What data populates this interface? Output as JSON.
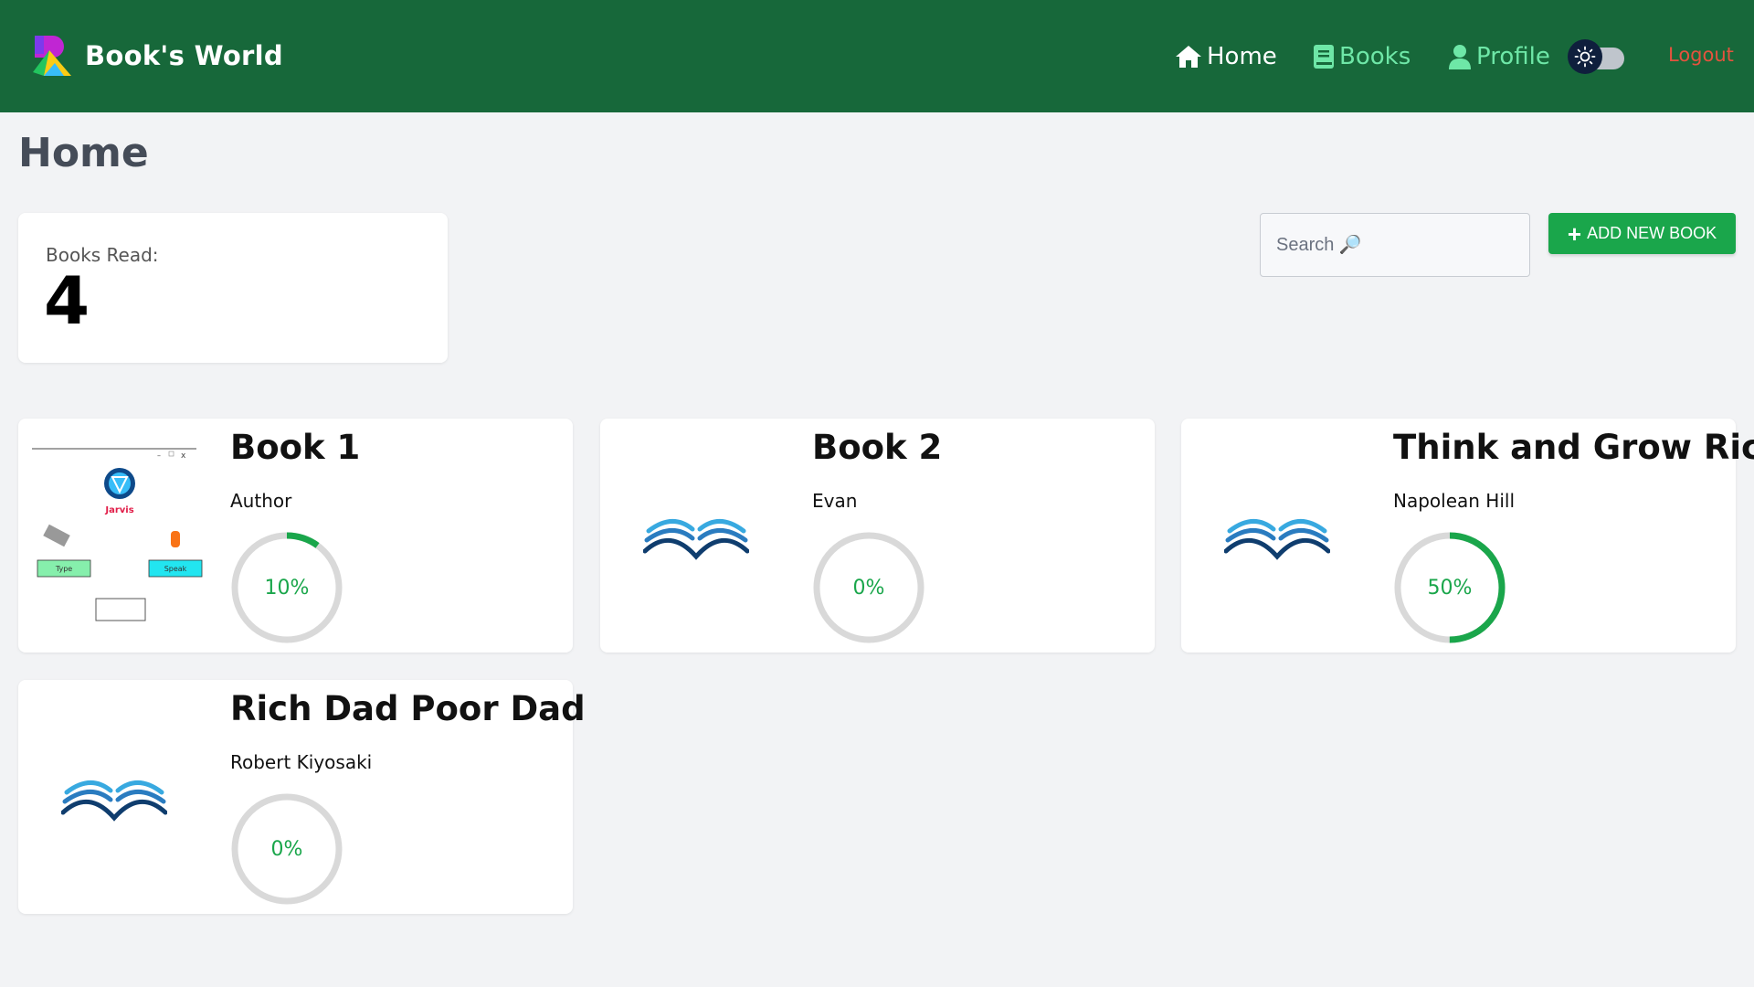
{
  "app": {
    "name": "Book's World",
    "accent_color": "#17683a",
    "button_color": "#1aa64b",
    "logout_color": "#e4533e"
  },
  "nav": {
    "home": {
      "label": "Home",
      "icon": "home-icon"
    },
    "books": {
      "label": "Books",
      "icon": "book-icon"
    },
    "profile": {
      "label": "Profile",
      "icon": "user-icon"
    },
    "theme_toggle": {
      "icon": "sun-icon",
      "state": "off"
    },
    "logout": {
      "label": "Logout"
    }
  },
  "page": {
    "title": "Home"
  },
  "stats": {
    "books_read_label": "Books Read:",
    "books_read_value": "4"
  },
  "search": {
    "placeholder": "Search 🔎",
    "value": ""
  },
  "actions": {
    "add_book_label": "ADD NEW BOOK"
  },
  "books": [
    {
      "title": "Book 1",
      "author": "Author",
      "progress": 10,
      "progress_label": "10%",
      "cover": "screenshot-cover"
    },
    {
      "title": "Book 2",
      "author": "Evan",
      "progress": 0,
      "progress_label": "0%",
      "cover": "open-book-icon"
    },
    {
      "title": "Think and Grow Rich",
      "author": "Napolean Hill",
      "progress": 50,
      "progress_label": "50%",
      "cover": "open-book-icon"
    },
    {
      "title": "Rich Dad Poor Dad",
      "author": "Robert Kiyosaki",
      "progress": 0,
      "progress_label": "0%",
      "cover": "open-book-icon"
    }
  ],
  "cover_art": {
    "book1_window_title": "Jarvis",
    "book1_button_type": "Type",
    "book1_button_speak": "Speak"
  }
}
